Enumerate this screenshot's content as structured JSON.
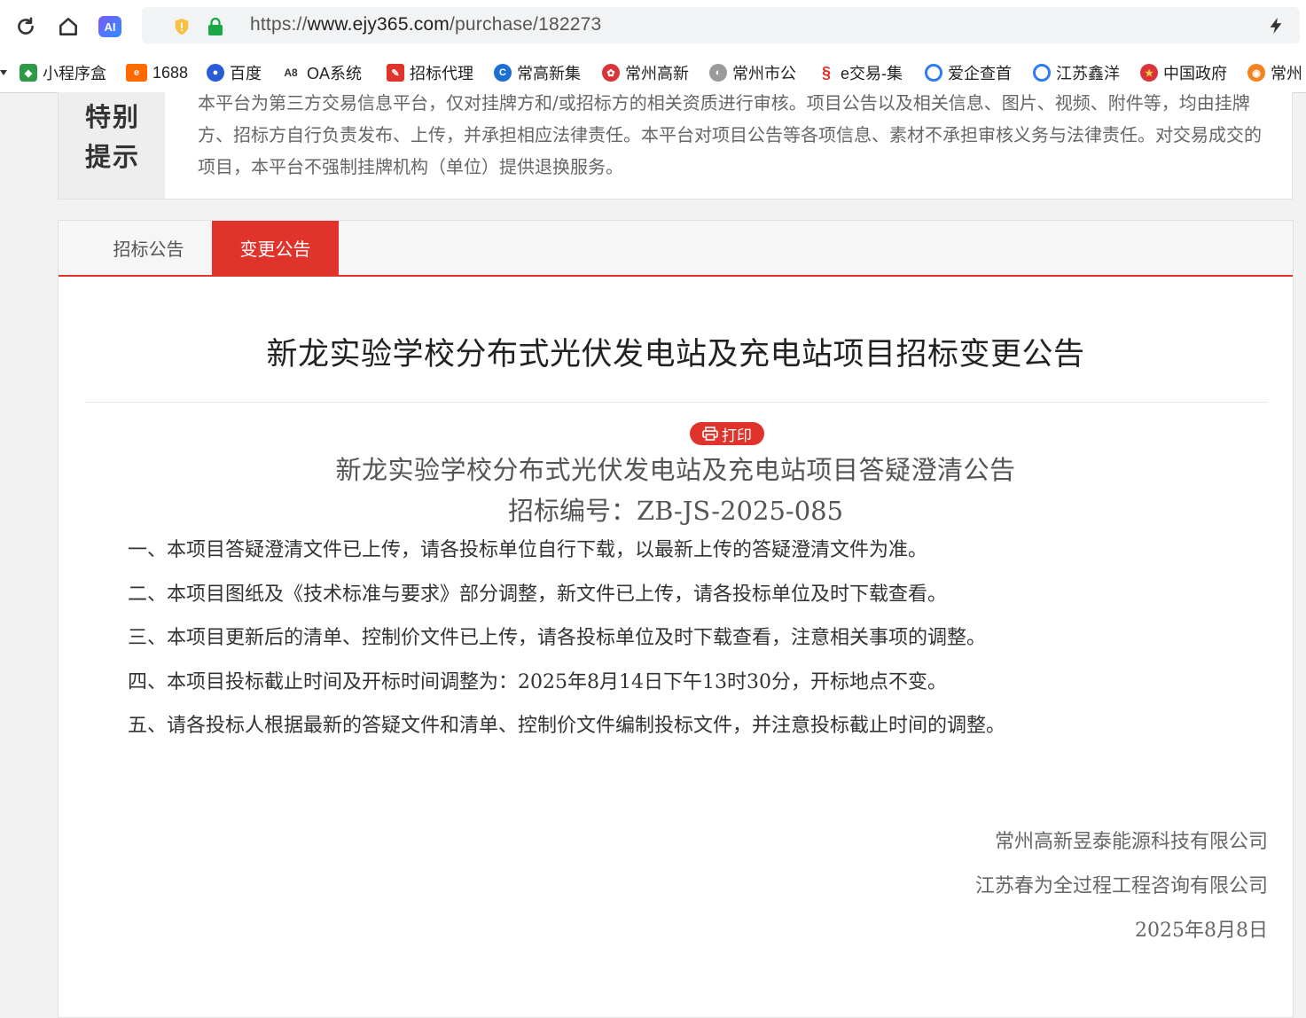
{
  "browser": {
    "url_prefix": "https://",
    "url_domain": "www.ejy365.com",
    "url_path": "/purchase/182273",
    "ai_label": "AI",
    "bookmarks": [
      {
        "label": "小程序盒",
        "icon": "shield-icon",
        "color": "#2e9a48"
      },
      {
        "label": "1688",
        "icon": "1688-icon",
        "color": "#ff6a00"
      },
      {
        "label": "百度",
        "icon": "baidu-paw-icon",
        "color": "#2b5bd7"
      },
      {
        "label": "OA系统",
        "icon": "oa-icon",
        "color": "#333333"
      },
      {
        "label": "招标代理",
        "icon": "pdf-icon",
        "color": "#e0332b"
      },
      {
        "label": "常高新集",
        "icon": "chang-gaoxin-icon",
        "color": "#1a6fd1"
      },
      {
        "label": "常州高新",
        "icon": "badge-icon",
        "color": "#d9343a"
      },
      {
        "label": "常州市公",
        "icon": "globe-icon",
        "color": "#9a9a9a"
      },
      {
        "label": "e交易-集",
        "icon": "e-trade-icon",
        "color": "#e0332b"
      },
      {
        "label": "爱企查首",
        "icon": "aiqicha-icon",
        "color": "#2f7bf5"
      },
      {
        "label": "江苏鑫洋",
        "icon": "aiqicha-icon",
        "color": "#2f7bf5"
      },
      {
        "label": "中国政府",
        "icon": "emblem-icon",
        "color": "#d9343a"
      },
      {
        "label": "常州",
        "icon": "weibo-icon",
        "color": "#f58220"
      }
    ]
  },
  "notice": {
    "heading": "特别提示",
    "text": "本平台为第三方交易信息平台，仅对挂牌方和/或招标方的相关资质进行审核。项目公告以及相关信息、图片、视频、附件等，均由挂牌方、招标方自行负责发布、上传，并承担相应法律责任。本平台对项目公告等各项信息、素材不承担审核义务与法律责任。对交易成交的项目，本平台不强制挂牌机构（单位）提供退换服务。"
  },
  "tabs": [
    {
      "label": "招标公告",
      "active": false
    },
    {
      "label": "变更公告",
      "active": true
    }
  ],
  "announcement": {
    "title": "新龙实验学校分布式光伏发电站及充电站项目招标变更公告",
    "print_label": "打印",
    "doc_title": "新龙实验学校分布式光伏发电站及充电站项目答疑澄清公告",
    "doc_code": "招标编号：ZB-JS-2025-085",
    "items": [
      "一、本项目答疑澄清文件已上传，请各投标单位自行下载，以最新上传的答疑澄清文件为准。",
      "二、本项目图纸及《技术标准与要求》部分调整，新文件已上传，请各投标单位及时下载查看。",
      "三、本项目更新后的清单、控制价文件已上传，请各投标单位及时下载查看，注意相关事项的调整。",
      "四、本项目投标截止时间及开标时间调整为：2025年8月14日下午13时30分，开标地点不变。",
      "五、请各投标人根据最新的答疑文件和清单、控制价文件编制投标文件，并注意投标截止时间的调整。"
    ],
    "signatures": {
      "company1": "常州高新昱泰能源科技有限公司",
      "company2": "江苏春为全过程工程咨询有限公司",
      "date": "2025年8月8日"
    }
  },
  "colors": {
    "accent": "#e0332b",
    "page_bg": "#f2f2f2"
  }
}
